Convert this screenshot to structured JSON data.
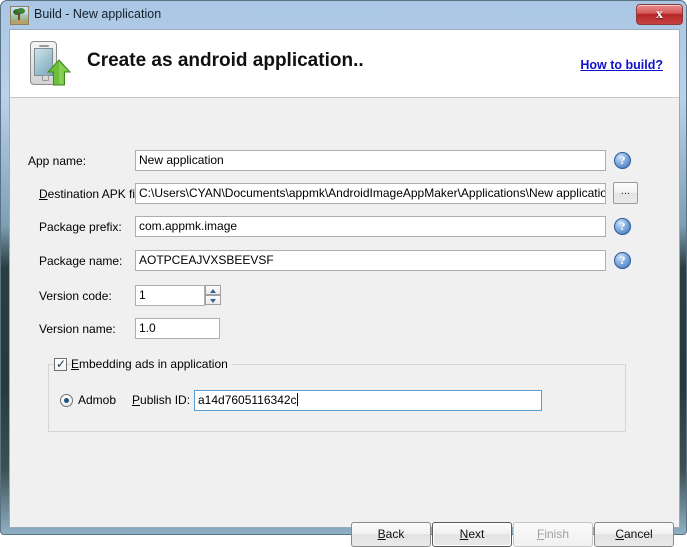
{
  "window": {
    "title": "Build - New application",
    "title_icon": "image-thumbnail-icon",
    "close_label": "x"
  },
  "header": {
    "icon": "android-phone-upload-icon",
    "title": "Create as android application..",
    "link_label": "How to build?"
  },
  "form": {
    "app_name": {
      "label_pre": "App name:",
      "value": "New application",
      "help": "?"
    },
    "destination_apk": {
      "label_mnemonic": "D",
      "label_rest": "estination APK file:",
      "value": "C:\\Users\\CYAN\\Documents\\appmk\\AndroidImageAppMaker\\Applications\\New application.apk",
      "browse_label": "..."
    },
    "package_prefix": {
      "label": "Package prefix:",
      "value": "com.appmk.image",
      "help": "?"
    },
    "package_name": {
      "label": "Package name:",
      "value": "AOTPCEAJVXSBEEVSF",
      "help": "?"
    },
    "version_code": {
      "label": "Version code:",
      "value": "1"
    },
    "version_name": {
      "label": "Version name:",
      "value": "1.0"
    }
  },
  "ads": {
    "checkbox_checked": true,
    "checkbox_mnemonic": "E",
    "checkbox_rest": "mbedding ads in application",
    "radio_selected": true,
    "radio_label": "Admob",
    "publish_id_mnemonic": "P",
    "publish_id_rest": "ublish ID:",
    "publish_id_value": "a14d7605116342c"
  },
  "buttons": {
    "back": {
      "mnemonic": "B",
      "rest": "ack"
    },
    "next": {
      "mnemonic": "N",
      "rest": "ext"
    },
    "finish": {
      "mnemonic": "F",
      "rest": "inish",
      "disabled": true
    },
    "cancel": {
      "mnemonic": "C",
      "rest": "ancel"
    }
  },
  "colors": {
    "link": "#1111CC",
    "close_button": "#C84141",
    "accent": "#3D6FB5",
    "client_bg": "#F0F0F0"
  }
}
